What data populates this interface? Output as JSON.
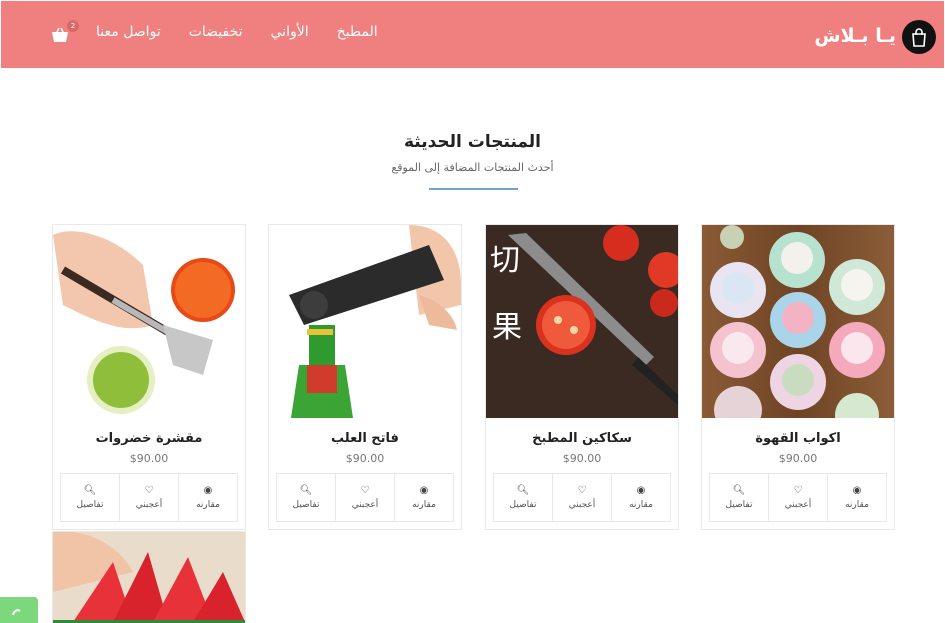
{
  "brand": {
    "name": "يـا بـلاش",
    "logo_icon": "shopping-bag-icon"
  },
  "nav": {
    "items": [
      {
        "label": "المطبخ"
      },
      {
        "label": "الأواني"
      },
      {
        "label": "تخفيضات"
      },
      {
        "label": "تواصل معنا"
      }
    ],
    "cart_count": "2",
    "cart_icon": "cart-icon"
  },
  "section": {
    "title": "المنتجات الحديثة",
    "subtitle": "أحدث المنتجات المضافة إلى الموقع"
  },
  "actions": {
    "compare": "مقارنه",
    "like": "أعجبني",
    "details": "تفاصيل"
  },
  "products": [
    {
      "name": "اكواب القهوة",
      "price": "$90.00"
    },
    {
      "name": "سكاكين المطبخ",
      "price": "$90.00"
    },
    {
      "name": "فاتح العلب",
      "price": "$90.00"
    },
    {
      "name": "مقشرة خضروات",
      "price": "$90.00"
    }
  ],
  "colors": {
    "navbar": "#f08080",
    "accent_line": "#6fa8c9",
    "whatsapp": "#7dd87d"
  }
}
